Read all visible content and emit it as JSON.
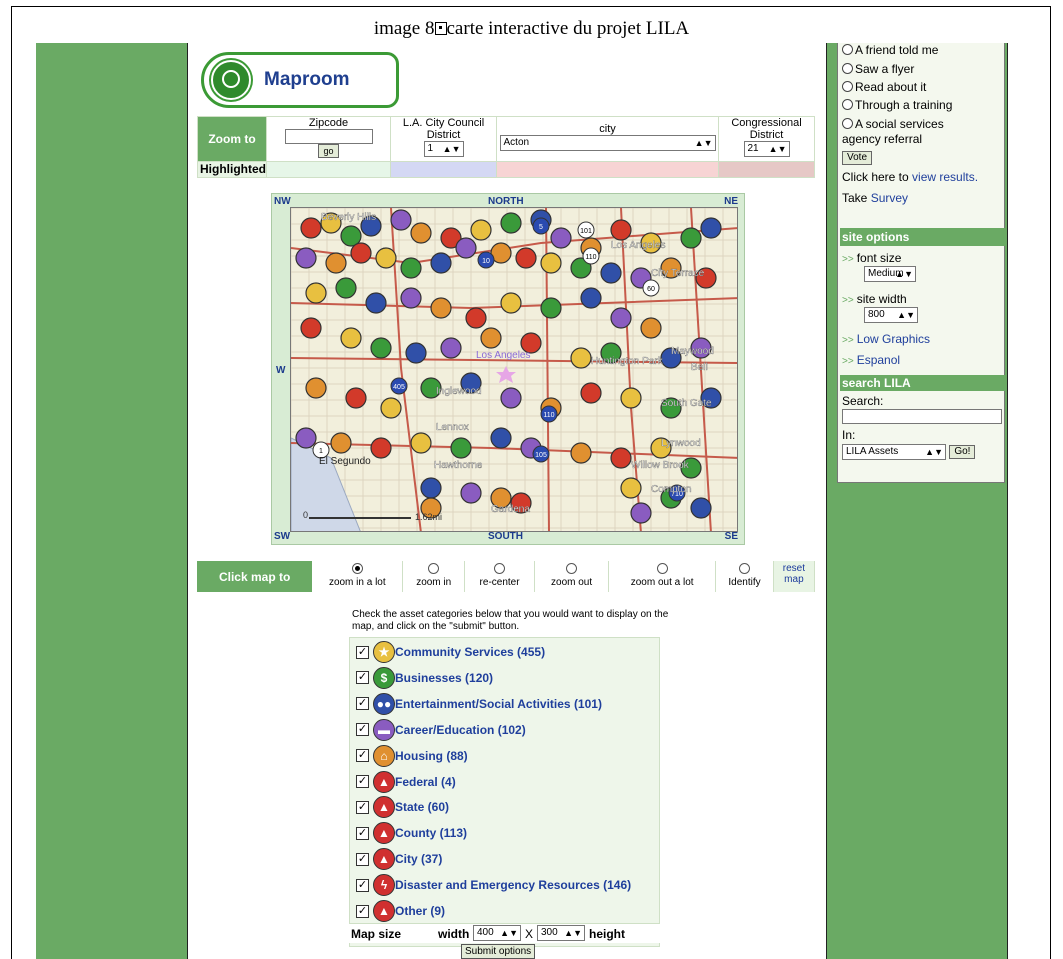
{
  "caption": {
    "prefix": "image 8",
    "text": "carte interactive du projet LILA"
  },
  "logo": {
    "label": "Maproom"
  },
  "zoom": {
    "label": "Zoom to",
    "highlighted": "Highlighted",
    "zipcode_label": "Zipcode",
    "go": "go",
    "council_label_1": "L.A. City Council",
    "council_label_2": "District",
    "council_value": "1",
    "city_label": "city",
    "city_value": "Acton",
    "congress_label_1": "Congressional",
    "congress_label_2": "District",
    "congress_value": "21"
  },
  "map": {
    "nw": "NW",
    "north": "NORTH",
    "ne": "NE",
    "w": "W",
    "e": "E",
    "sw": "SW",
    "south": "SOUTH",
    "se": "SE",
    "scale_start": "0",
    "scale_end": "1.62mi",
    "places": [
      "Beverly Hills",
      "Los Angeles",
      "City Terrace",
      "Los Angeles",
      "Huntington Park",
      "Maywood",
      "Bell",
      "Inglewood",
      "South Gate",
      "Lennox",
      "Lynwood",
      "El Segundo",
      "Hawthorne",
      "Willow Brook",
      "Compton",
      "Gardena"
    ],
    "shields": [
      "101",
      "110",
      "10",
      "60",
      "405",
      "110",
      "105",
      "710",
      "1",
      "5"
    ]
  },
  "clickmap": {
    "label": "Click map to",
    "options": [
      "zoom in a lot",
      "zoom in",
      "re-center",
      "zoom out",
      "zoom out a lot",
      "Identify"
    ],
    "selected_index": 0,
    "reset_1": "reset",
    "reset_2": "map"
  },
  "assets": {
    "instructions": "Check the asset categories below that you would want to display on the map, and click on the \"submit\" button.",
    "items": [
      {
        "label": "Community Services (455)",
        "icon": "star-icon",
        "color": "#e8c040"
      },
      {
        "label": "Businesses (120)",
        "icon": "dollar-icon",
        "color": "#3a9a3a"
      },
      {
        "label": "Entertainment/Social Activities (101)",
        "icon": "people-icon",
        "color": "#3050a8"
      },
      {
        "label": "Career/Education (102)",
        "icon": "book-icon",
        "color": "#8a5cc0"
      },
      {
        "label": "Housing (88)",
        "icon": "house-icon",
        "color": "#e09030"
      },
      {
        "label": "Federal (4)",
        "icon": "government-icon",
        "color": "#d03030"
      },
      {
        "label": "State (60)",
        "icon": "government-icon",
        "color": "#d03030"
      },
      {
        "label": "County (113)",
        "icon": "government-icon",
        "color": "#d03030"
      },
      {
        "label": "City (37)",
        "icon": "government-icon",
        "color": "#d03030"
      },
      {
        "label": "Disaster and Emergency Resources (146)",
        "icon": "lightning-icon",
        "color": "#d03030"
      },
      {
        "label": "Other (9)",
        "icon": "government-icon",
        "color": "#d03030"
      }
    ],
    "map_size_label": "Map size",
    "width_label": "width",
    "width_value": "400",
    "x_label": "X",
    "height_value": "300",
    "height_label": "height",
    "submit": "Submit options"
  },
  "sidebar": {
    "survey_options": [
      "A friend told me",
      "Saw a flyer",
      "Read about it",
      "Through a training",
      "A social services"
    ],
    "survey_option_cont": "agency referral",
    "vote": "Vote",
    "results_prefix": "Click here to ",
    "results_link": "view results.",
    "take_prefix": "Take ",
    "survey_link": "Survey",
    "site_options_head": "site options",
    "font_size_label": "font size",
    "font_size_value": "Medium",
    "site_width_label": "site width",
    "site_width_value": "800",
    "low_graphics": "Low Graphics",
    "espanol": "Espanol",
    "search_head": "search LILA",
    "search_label": "Search:",
    "in_label": "In:",
    "in_value": "LILA Assets",
    "go": "Go!"
  },
  "colors": {
    "green": "#6aaa64",
    "link": "#1f3f9c"
  }
}
